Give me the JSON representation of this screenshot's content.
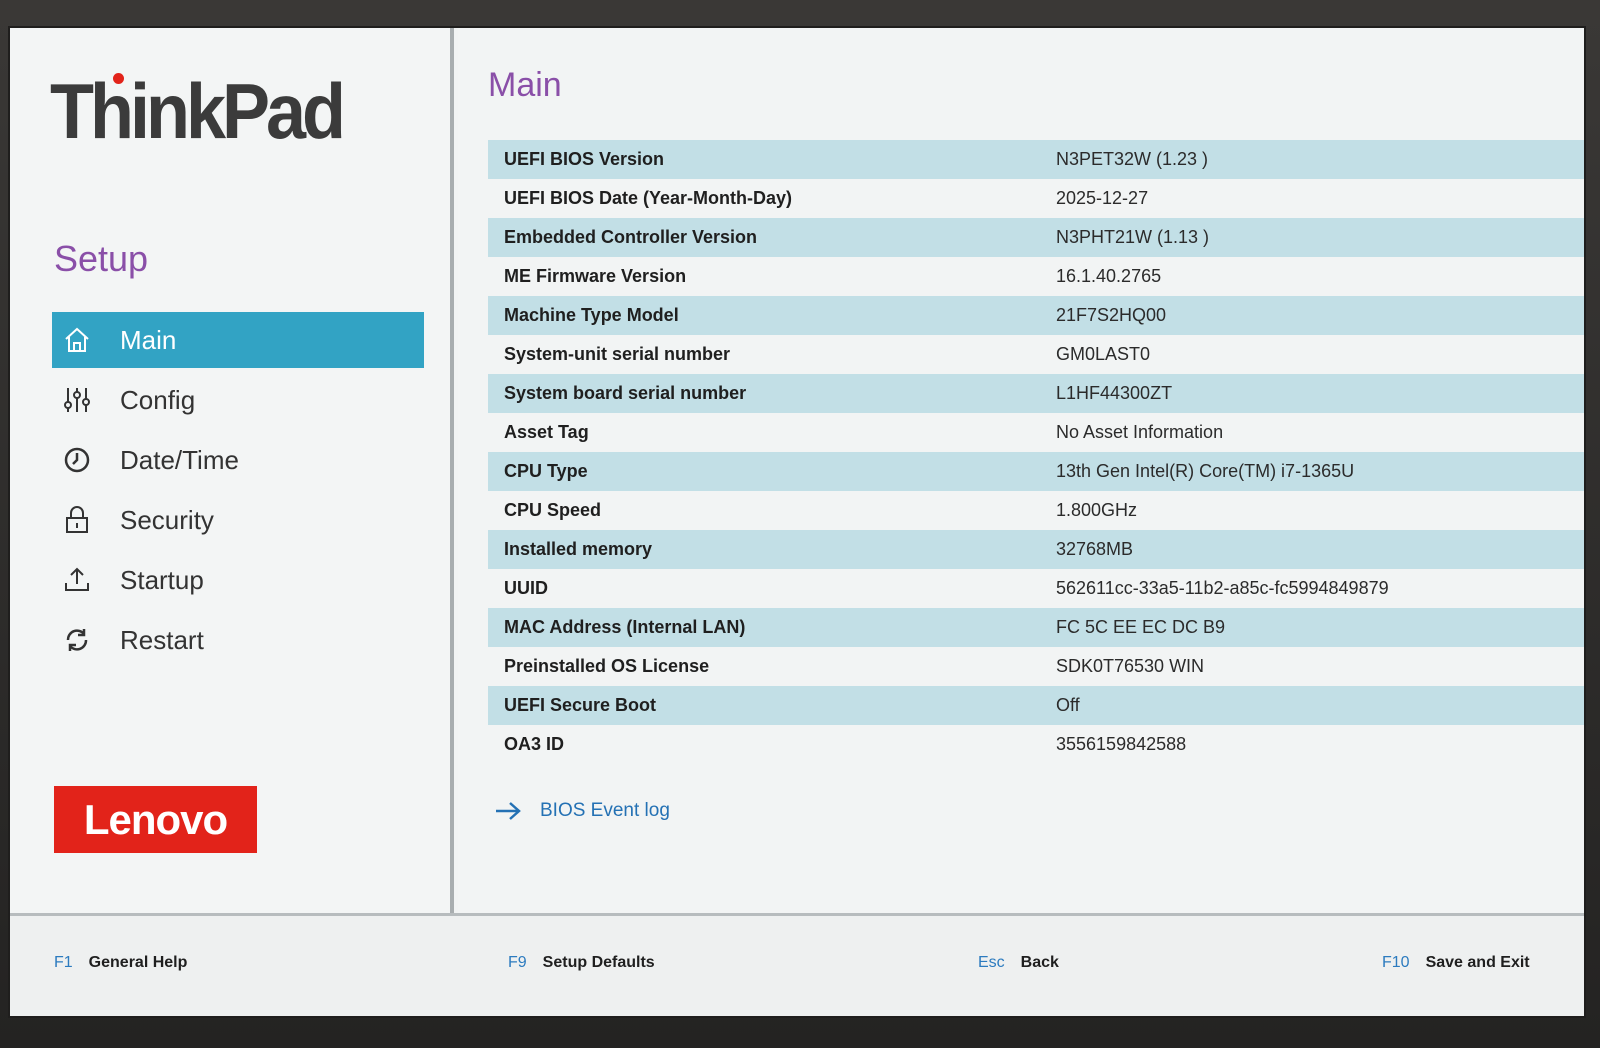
{
  "brand": {
    "name": "ThinkPad",
    "vendor": "Lenovo"
  },
  "sidebar": {
    "title": "Setup",
    "items": [
      {
        "label": "Main",
        "icon": "home-icon",
        "active": true
      },
      {
        "label": "Config",
        "icon": "sliders-icon",
        "active": false
      },
      {
        "label": "Date/Time",
        "icon": "clock-icon",
        "active": false
      },
      {
        "label": "Security",
        "icon": "lock-icon",
        "active": false
      },
      {
        "label": "Startup",
        "icon": "upload-icon",
        "active": false
      },
      {
        "label": "Restart",
        "icon": "refresh-icon",
        "active": false
      }
    ]
  },
  "main": {
    "title": "Main",
    "rows": [
      {
        "label": "UEFI BIOS Version",
        "value": "N3PET32W (1.23 )"
      },
      {
        "label": "UEFI BIOS Date (Year-Month-Day)",
        "value": "2025-12-27"
      },
      {
        "label": "Embedded Controller Version",
        "value": "N3PHT21W (1.13 )"
      },
      {
        "label": "ME Firmware Version",
        "value": "16.1.40.2765"
      },
      {
        "label": "Machine Type Model",
        "value": "21F7S2HQ00"
      },
      {
        "label": "System-unit serial number",
        "value": "GM0LAST0"
      },
      {
        "label": "System board serial number",
        "value": "L1HF44300ZT"
      },
      {
        "label": "Asset Tag",
        "value": "No Asset Information"
      },
      {
        "label": "CPU Type",
        "value": "13th Gen Intel(R) Core(TM) i7-1365U"
      },
      {
        "label": "CPU Speed",
        "value": "1.800GHz"
      },
      {
        "label": "Installed memory",
        "value": "32768MB"
      },
      {
        "label": "UUID",
        "value": "562611cc-33a5-11b2-a85c-fc5994849879"
      },
      {
        "label": "MAC Address (Internal LAN)",
        "value": "FC 5C EE EC DC B9"
      },
      {
        "label": "Preinstalled OS License",
        "value": "SDK0T76530 WIN"
      },
      {
        "label": "UEFI Secure Boot",
        "value": "Off"
      },
      {
        "label": "OA3 ID",
        "value": "3556159842588"
      }
    ],
    "event_log_link": "BIOS Event log"
  },
  "footer": {
    "keys": [
      {
        "key": "F1",
        "desc": "General Help"
      },
      {
        "key": "F9",
        "desc": "Setup Defaults"
      },
      {
        "key": "Esc",
        "desc": "Back"
      },
      {
        "key": "F10",
        "desc": "Save and Exit"
      }
    ]
  },
  "colors": {
    "accent_purple": "#8a4fa8",
    "active_blue": "#32a3c4",
    "row_shade": "#c2dfe6",
    "link_blue": "#2471b4",
    "lenovo_red": "#e2231a"
  }
}
